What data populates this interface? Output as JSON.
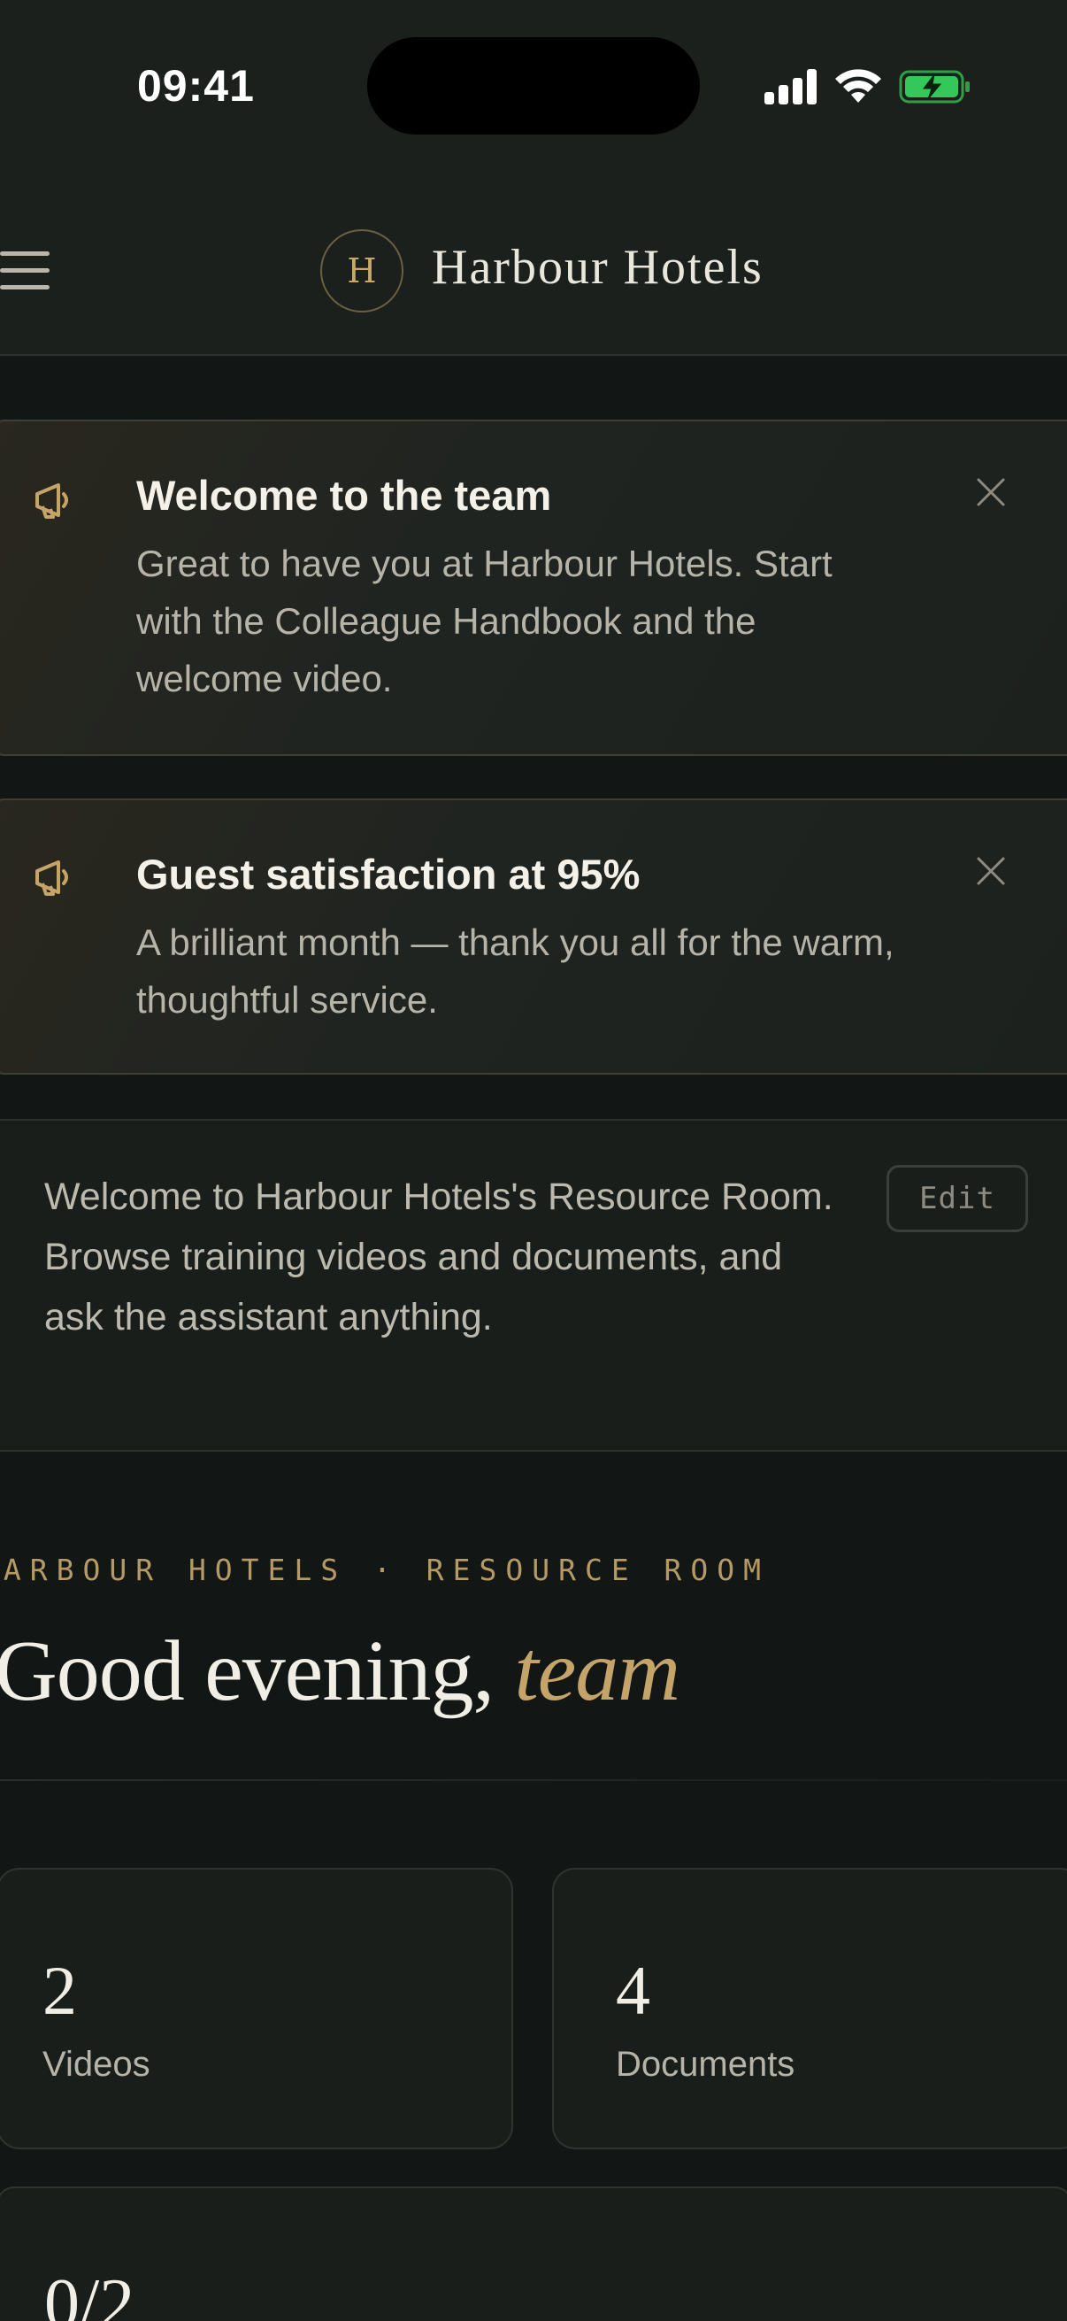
{
  "status_bar": {
    "time": "09:41"
  },
  "header": {
    "logo_letter": "H",
    "brand_name": "Harbour Hotels"
  },
  "announcements": [
    {
      "title": "Welcome to the team",
      "body": "Great to have you at Harbour Hotels. Start with the Colleague Handbook and the welcome video.",
      "icon": "megaphone-icon"
    },
    {
      "title": "Guest satisfaction at 95%",
      "body": "A brilliant month — thank you all for the warm, thoughtful service.",
      "icon": "megaphone-icon"
    }
  ],
  "intro": {
    "text": "Welcome to Harbour Hotels's Resource Room. Browse training videos and documents, and ask the assistant anything.",
    "edit_label": "Edit"
  },
  "hero": {
    "eyebrow": "HARBOUR HOTELS · RESOURCE ROOM",
    "greeting": "Good evening,",
    "greeting_name": "team"
  },
  "stats": [
    {
      "value": "2",
      "label": "Videos"
    },
    {
      "value": "4",
      "label": "Documents"
    }
  ],
  "progress": {
    "value": "0/2"
  },
  "colors": {
    "accent_gold": "#c5a46a",
    "background": "#121614",
    "card": "#1a1e1b",
    "battery_green": "#34c759"
  }
}
